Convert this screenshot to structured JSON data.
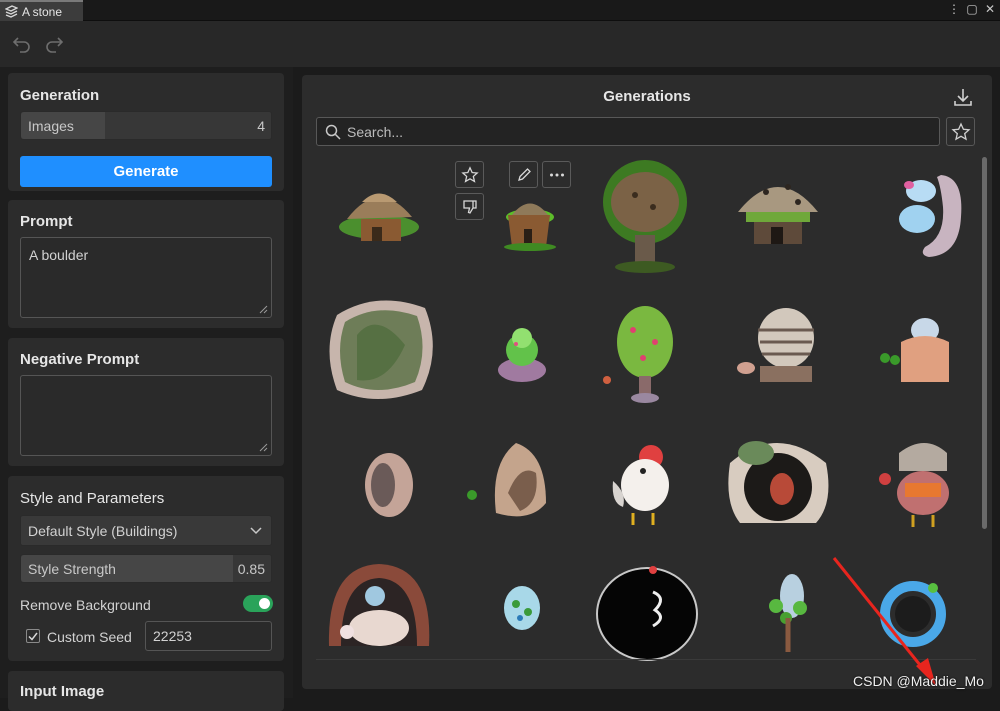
{
  "tab": {
    "title": "A stone"
  },
  "generation": {
    "title": "Generation",
    "images_label": "Images",
    "images_value": "4",
    "generate_label": "Generate"
  },
  "prompt": {
    "title": "Prompt",
    "value": "A boulder"
  },
  "negative_prompt": {
    "title": "Negative Prompt",
    "value": ""
  },
  "style": {
    "title": "Style and Parameters",
    "selected_style": "Default Style (Buildings)",
    "strength_label": "Style Strength",
    "strength_value": "0.85",
    "strength_level": 0.85,
    "remove_bg_label": "Remove Background",
    "remove_bg_on": true,
    "custom_seed_label": "Custom Seed",
    "custom_seed_checked": true,
    "seed_value": "22253"
  },
  "input_image": {
    "title": "Input Image"
  },
  "generations": {
    "title": "Generations",
    "search_placeholder": "Search...",
    "image_count": 20
  },
  "watermark": "CSDN @Maddie_Mo",
  "colors": {
    "accent": "#1f8fff",
    "toggle_on": "#2aa35a",
    "panel": "#2c2c2c"
  }
}
